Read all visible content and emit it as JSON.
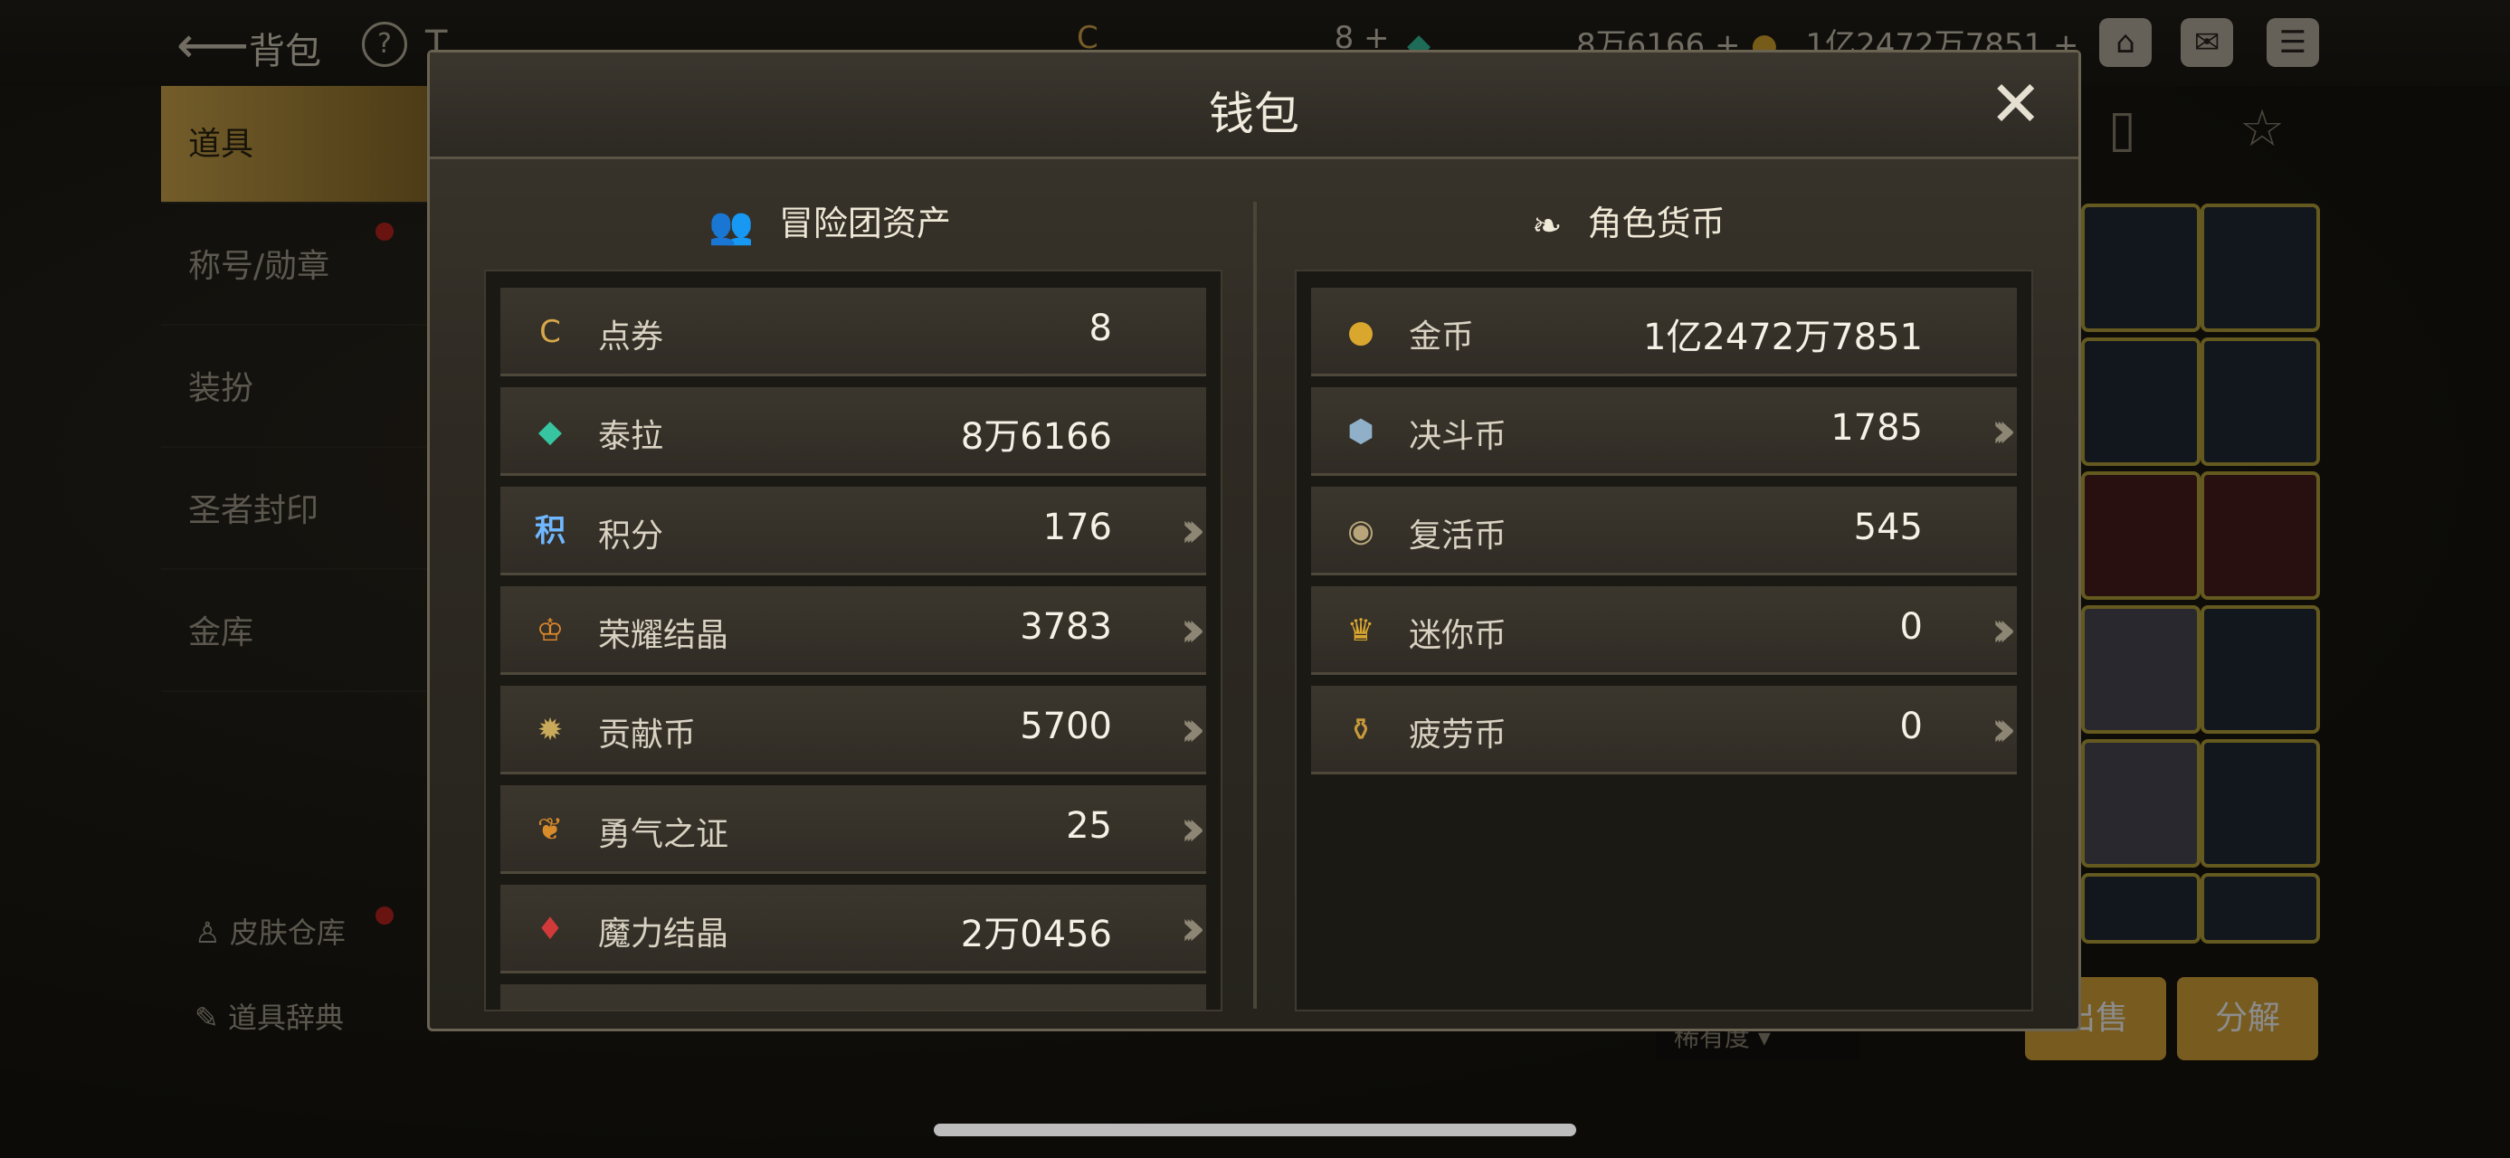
{
  "topbar": {
    "back_label": "背包",
    "resources": [
      {
        "icon": "coupon-icon",
        "value": "8"
      },
      {
        "icon": "tera-icon",
        "value": "8万6166"
      },
      {
        "icon": "gold-icon",
        "value": "1亿2472万7851"
      }
    ]
  },
  "sidebar": {
    "items": [
      {
        "label": "道具",
        "active": true
      },
      {
        "label": "称号/勋章",
        "active": false
      },
      {
        "label": "装扮",
        "active": false
      },
      {
        "label": "圣者封印",
        "active": false
      },
      {
        "label": "金库",
        "active": false
      }
    ],
    "bottom": [
      {
        "label": "皮肤仓库"
      },
      {
        "label": "道具辞典"
      }
    ]
  },
  "bottom_buttons": {
    "sell": "出售",
    "decompose": "分解",
    "sort": "稀有度"
  },
  "modal": {
    "title": "钱包",
    "left": {
      "title": "冒险团资产",
      "rows": [
        {
          "icon": "coupon-icon",
          "label": "点券",
          "value": "8",
          "arrow": false,
          "color": "#d6a84a"
        },
        {
          "icon": "tera-gem-icon",
          "label": "泰拉",
          "value": "8万6166",
          "arrow": false,
          "color": "#37c4a0"
        },
        {
          "icon": "points-icon",
          "label": "积分",
          "value": "176",
          "arrow": true,
          "color": "#6fb7ff"
        },
        {
          "icon": "glory-crystal-icon",
          "label": "荣耀结晶",
          "value": "3783",
          "arrow": true,
          "color": "#e0892a"
        },
        {
          "icon": "contribution-coin-icon",
          "label": "贡献币",
          "value": "5700",
          "arrow": true,
          "color": "#c9a95a"
        },
        {
          "icon": "courage-proof-icon",
          "label": "勇气之证",
          "value": "25",
          "arrow": true,
          "color": "#d88b2a"
        },
        {
          "icon": "magic-crystal-icon",
          "label": "魔力结晶",
          "value": "2万0456",
          "arrow": true,
          "color": "#d23a3a"
        }
      ]
    },
    "right": {
      "title": "角色货币",
      "rows": [
        {
          "icon": "gold-coin-icon",
          "label": "金币",
          "value": "1亿2472万7851",
          "arrow": false,
          "color": "#d9a72e"
        },
        {
          "icon": "duel-coin-icon",
          "label": "决斗币",
          "value": "1785",
          "arrow": true,
          "color": "#8fb0c8"
        },
        {
          "icon": "revive-coin-icon",
          "label": "复活币",
          "value": "545",
          "arrow": false,
          "color": "#b9a57a"
        },
        {
          "icon": "mini-coin-icon",
          "label": "迷你币",
          "value": "0",
          "arrow": true,
          "color": "#d9a72e"
        },
        {
          "icon": "fatigue-coin-icon",
          "label": "疲劳币",
          "value": "0",
          "arrow": true,
          "color": "#c99a3a"
        }
      ]
    }
  }
}
